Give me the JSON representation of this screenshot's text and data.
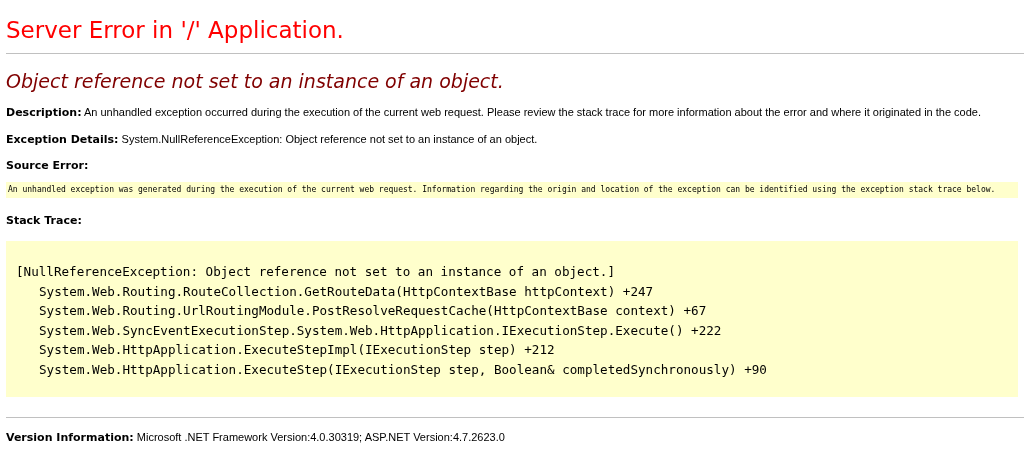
{
  "title": "Server Error in '/' Application.",
  "error_message": "Object reference not set to an instance of an object.",
  "description": "**Description:** An unhandled exception occurred during the execution of the current web request. Please review the stack trace for more information about the error and where it originated in the code.",
  "exception_details": "**Exception Details:** System.NullReferenceException: Object reference not set to an instance of an object.",
  "source_error": {
    "heading": "Source Error:",
    "text": "An unhandled exception was generated during the execution of the current web request. Information regarding the origin and location of the exception can be identified using the exception stack trace below."
  },
  "stack_trace": {
    "heading": "Stack Trace:",
    "exception": "[NullReferenceException: Object reference not set to an instance of an object.]",
    "frames": [
      "System.Web.Routing.RouteCollection.GetRouteData(HttpContextBase httpContext) +247",
      "System.Web.Routing.UrlRoutingModule.PostResolveRequestCache(HttpContextBase context) +67",
      "System.Web.SyncEventExecutionStep.System.Web.HttpApplication.IExecutionStep.Execute() +222",
      "System.Web.HttpApplication.ExecuteStepImpl(IExecutionStep step) +212",
      "System.Web.HttpApplication.ExecuteStep(IExecutionStep step, Boolean& completedSynchronously) +90"
    ]
  },
  "version_information": "**Version Information:** Microsoft .NET Framework Version:4.0.30319; ASP.NET Version:4.7.2623.0"
}
